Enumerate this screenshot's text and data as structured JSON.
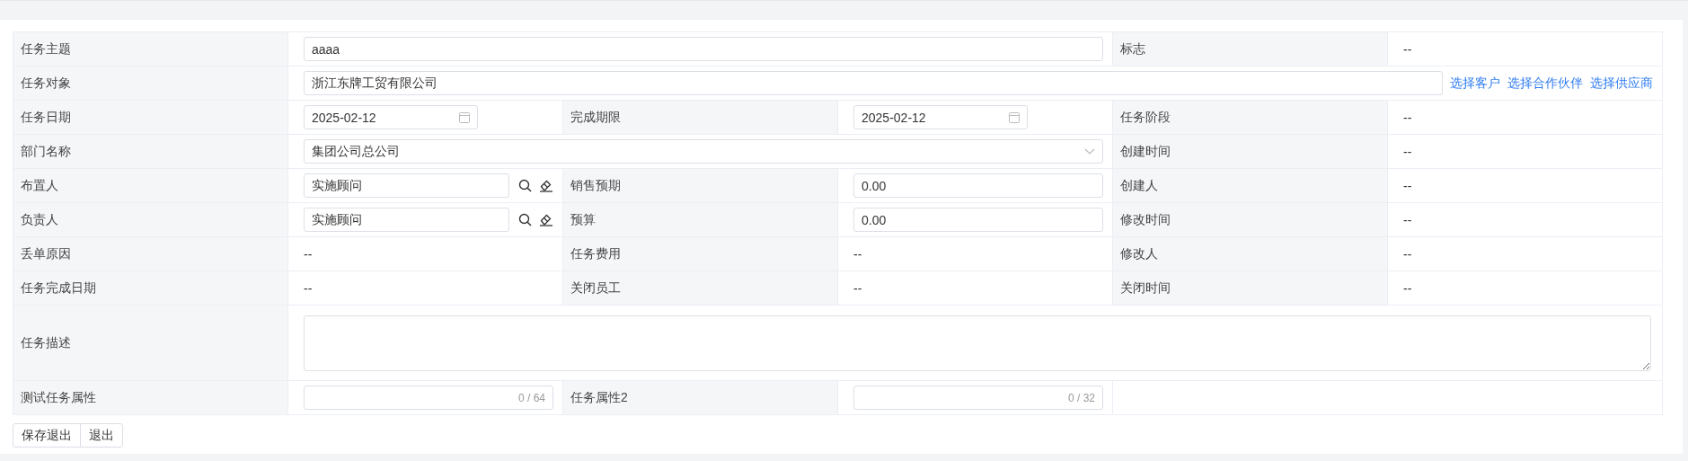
{
  "rows": [
    {
      "fields": [
        {
          "label": "任务主题",
          "control": {
            "kind": "text",
            "value": "aaaa"
          }
        },
        {
          "label": "标志",
          "control": {
            "kind": "static",
            "value": "--"
          }
        }
      ]
    },
    {
      "fields": [
        {
          "label": "任务对象",
          "control": {
            "kind": "text",
            "value": "浙江东牌工贸有限公司",
            "links": [
              "选择客户",
              "选择合作伙伴",
              "选择供应商"
            ]
          }
        }
      ]
    },
    {
      "fields": [
        {
          "label": "任务日期",
          "control": {
            "kind": "date",
            "value": "2025-02-12"
          }
        },
        {
          "label": "完成期限",
          "control": {
            "kind": "date",
            "value": "2025-02-12"
          }
        },
        {
          "label": "任务阶段",
          "control": {
            "kind": "static",
            "value": "--"
          }
        }
      ]
    },
    {
      "fields": [
        {
          "label": "部门名称",
          "control": {
            "kind": "select",
            "value": "集团公司总公司"
          }
        },
        {
          "label": "创建时间",
          "control": {
            "kind": "static",
            "value": "--"
          }
        }
      ]
    },
    {
      "fields": [
        {
          "label": "布置人",
          "control": {
            "kind": "picker",
            "value": "实施顾问"
          }
        },
        {
          "label": "销售预期",
          "control": {
            "kind": "text",
            "value": "0.00"
          }
        },
        {
          "label": "创建人",
          "control": {
            "kind": "static",
            "value": "--"
          }
        }
      ]
    },
    {
      "fields": [
        {
          "label": "负责人",
          "control": {
            "kind": "picker",
            "value": "实施顾问"
          }
        },
        {
          "label": "预算",
          "control": {
            "kind": "text",
            "value": "0.00"
          }
        },
        {
          "label": "修改时间",
          "control": {
            "kind": "static",
            "value": "--"
          }
        }
      ]
    },
    {
      "fields": [
        {
          "label": "丢单原因",
          "control": {
            "kind": "static",
            "value": "--"
          }
        },
        {
          "label": "任务费用",
          "control": {
            "kind": "static",
            "value": "--"
          }
        },
        {
          "label": "修改人",
          "control": {
            "kind": "static",
            "value": "--"
          }
        }
      ]
    },
    {
      "fields": [
        {
          "label": "任务完成日期",
          "control": {
            "kind": "static",
            "value": "--"
          }
        },
        {
          "label": "关闭员工",
          "control": {
            "kind": "static",
            "value": "--"
          }
        },
        {
          "label": "关闭时间",
          "control": {
            "kind": "static",
            "value": "--"
          }
        }
      ]
    },
    {
      "fields": [
        {
          "label": "任务描述",
          "control": {
            "kind": "textarea"
          }
        }
      ]
    },
    {
      "fields": [
        {
          "label": "测试任务属性",
          "control": {
            "kind": "counter",
            "counter": "0 / 64"
          }
        },
        {
          "label": "任务属性2",
          "control": {
            "kind": "counter",
            "counter": "0 / 32"
          }
        }
      ]
    }
  ],
  "buttons": [
    "保存退出",
    "退出"
  ]
}
